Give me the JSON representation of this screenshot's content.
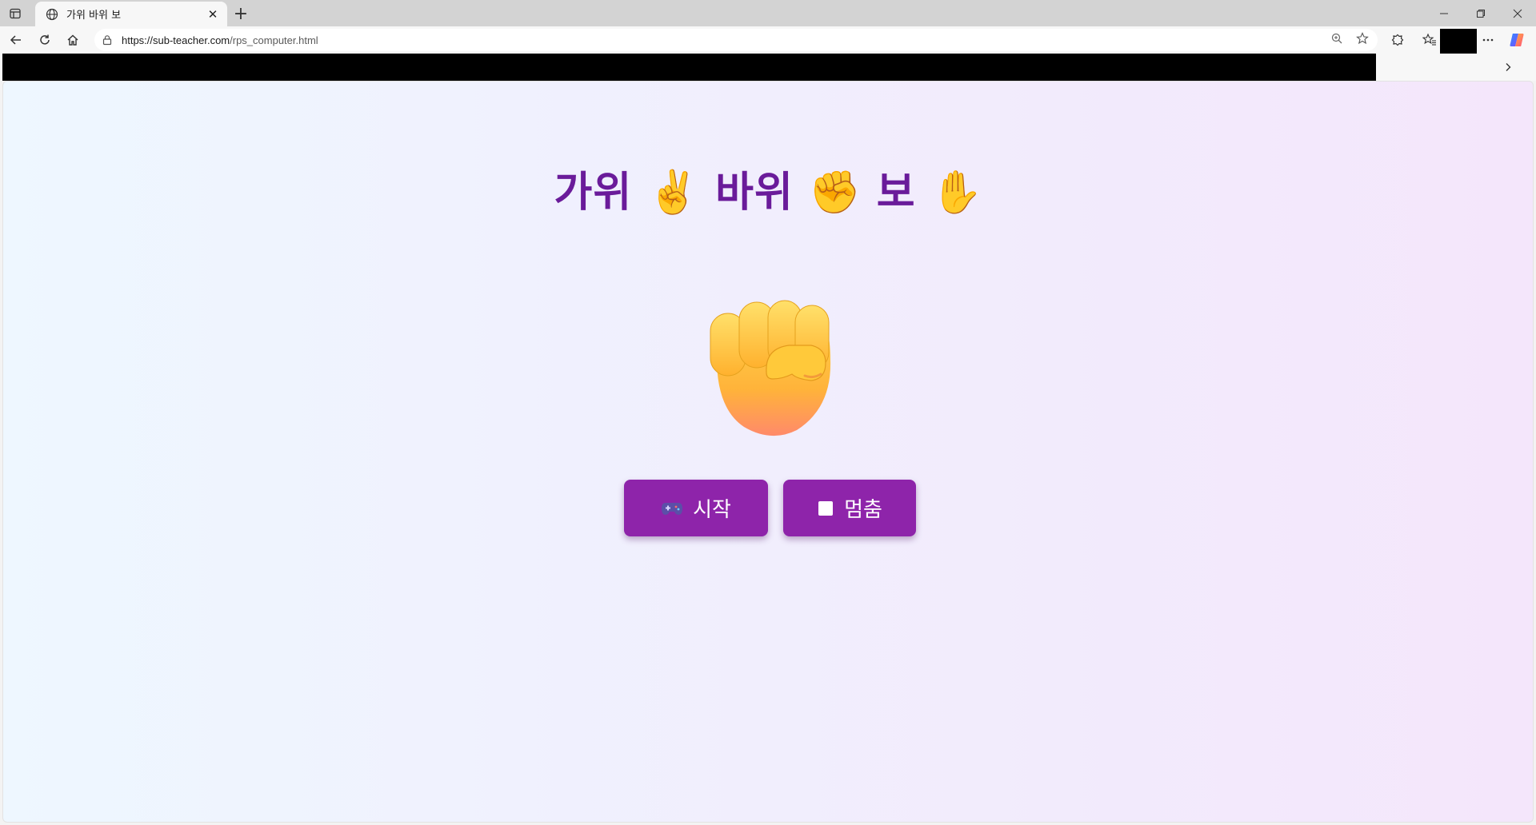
{
  "browser": {
    "tab_title": "가위 바위 보",
    "url_host": "https://sub-teacher.com",
    "url_path": "/rps_computer.html",
    "new_tab_label": "+",
    "close_tab_label": "✕"
  },
  "page": {
    "heading_word1": "가위",
    "heading_emoji1": "✌️",
    "heading_word2": "바위",
    "heading_emoji2": "✊",
    "heading_word3": "보",
    "heading_emoji3": "✋",
    "current_hand": "rock",
    "start_button_label": "시작",
    "stop_button_label": "멈춤",
    "colors": {
      "heading": "#6a1b9a",
      "button": "#8e24aa",
      "gradient_left": "#eef7ff",
      "gradient_right": "#f4e6fb"
    }
  }
}
